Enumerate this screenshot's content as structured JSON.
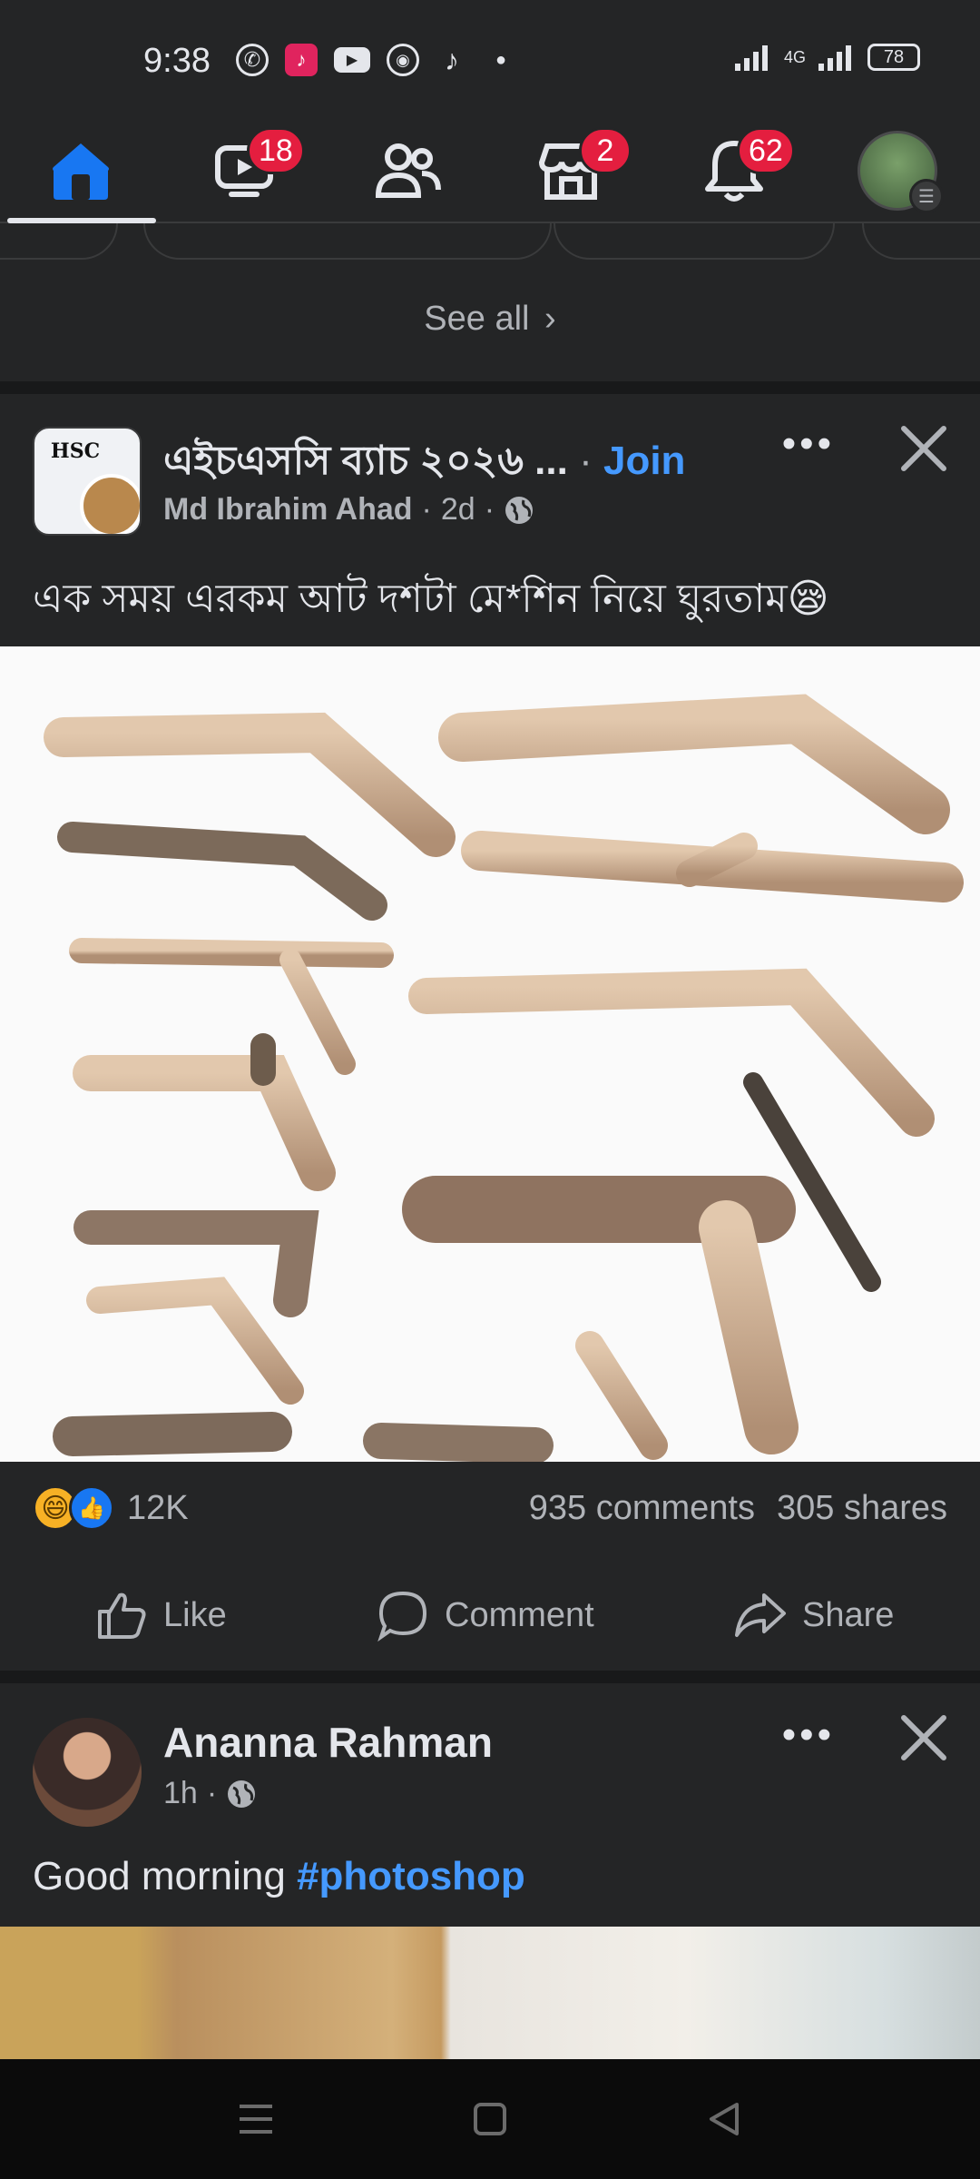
{
  "status_bar": {
    "time": "9:38",
    "network": "4G",
    "battery": "78"
  },
  "nav": {
    "video_badge": "18",
    "marketplace_badge": "2",
    "notifications_badge": "62"
  },
  "feed": {
    "see_all": "See all"
  },
  "post1": {
    "group_avatar_text": "HSC",
    "group_name": "এইচএসসি ব্যাচ ২০২৬ ...",
    "join": "Join",
    "author": "Md Ibrahim Ahad",
    "time": "2d",
    "text": "এক সময় এরকম আট দশটা মে*শিন নিয়ে ঘুরতাম😪",
    "reaction_count": "12K",
    "comments": "935 comments",
    "shares": "305 shares",
    "like": "Like",
    "comment": "Comment",
    "share": "Share"
  },
  "post2": {
    "author": "Ananna Rahman",
    "time": "1h",
    "text": "Good morning ",
    "hashtag": "#photoshop"
  },
  "colors": {
    "background": "#242526",
    "accent": "#4599ff",
    "badge": "#e41e3f",
    "home_active": "#1877f2"
  }
}
